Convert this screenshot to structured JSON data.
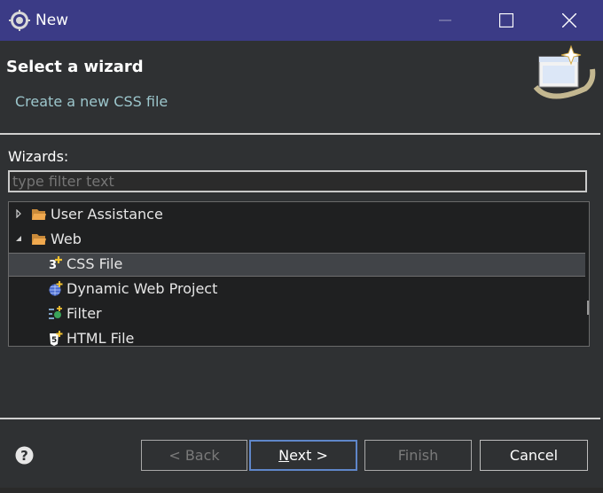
{
  "window": {
    "title": "New"
  },
  "header": {
    "title": "Select a wizard",
    "description": "Create a new CSS file"
  },
  "wizards": {
    "label": "Wizards:",
    "filter_placeholder": "type filter text",
    "tree": [
      {
        "label": "User Assistance",
        "icon": "folder-icon",
        "expanded": false
      },
      {
        "label": "Web",
        "icon": "folder-icon",
        "expanded": true
      },
      {
        "label": "CSS File",
        "icon": "css-file-icon",
        "selected": true
      },
      {
        "label": "Dynamic Web Project",
        "icon": "web-project-icon"
      },
      {
        "label": "Filter",
        "icon": "filter-icon"
      },
      {
        "label": "HTML File",
        "icon": "html-file-icon"
      }
    ]
  },
  "buttons": {
    "back": "< Back",
    "next_mnemonic": "N",
    "next_rest": "ext >",
    "finish": "Finish",
    "cancel": "Cancel"
  },
  "colors": {
    "titlebar": "#3b3b86",
    "background": "#2f3133",
    "description": "#9cc6cc",
    "default_button_border": "#5f86c9"
  }
}
